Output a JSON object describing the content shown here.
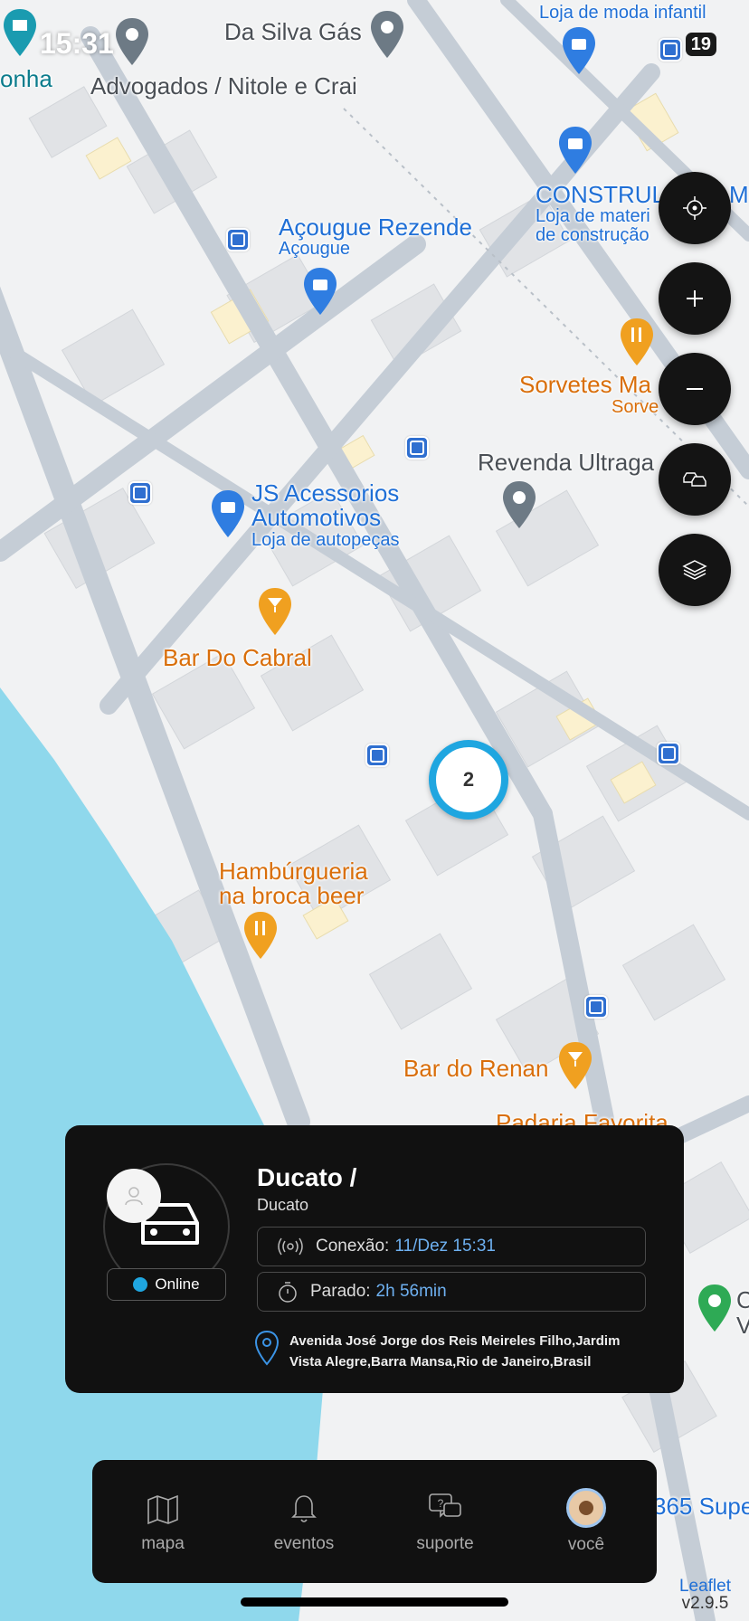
{
  "status_bar": {
    "time": "15:31",
    "battery": "19"
  },
  "map": {
    "labels": {
      "da_silva": "Da Silva Gás",
      "advogados": "Advogados / Nitole e Crai",
      "onha": "onha",
      "loja_moda": "Loja de moda infantil",
      "acougue_title": "Açougue Rezende",
      "acougue_sub": "Açougue",
      "construl_title": "CONSTRUL",
      "construl_title_right": "M",
      "construl_sub1": "Loja de materi",
      "construl_sub2": "de construção",
      "sorvetes_title": "Sorvetes Ma",
      "sorvetes_sub": "Sorve",
      "revenda": "Revenda Ultraga",
      "js_title1": "JS Acessorios",
      "js_title2": "Automotivos",
      "js_sub": "Loja de autopeças",
      "bar_cabral": "Bar Do Cabral",
      "hamb_1": "Hambúrgueria",
      "hamb_2": "na broca beer",
      "bar_renan": "Bar do Renan",
      "padaria": "Padaria Favorita",
      "supe": "365 Supe",
      "right_c": "C",
      "right_v": "V"
    },
    "cluster_count": "2",
    "colors": {
      "water": "#8fd8ec",
      "road": "#c5cdd6",
      "block": "#e2e4e7",
      "cluster_ring": "#1fa6e0"
    }
  },
  "controls": {
    "locate_icon": "crosshair-icon",
    "zoom_in_icon": "plus-icon",
    "zoom_out_icon": "minus-icon",
    "traffic_icon": "cars-icon",
    "layers_icon": "layers-icon"
  },
  "vehicle_card": {
    "title": "Ducato /",
    "subtitle": "Ducato",
    "status": "Online",
    "connection_label": "Conexão:",
    "connection_value": "11/Dez 15:31",
    "stopped_label": "Parado:",
    "stopped_value": "2h 56min",
    "address_line1": "Avenida José Jorge dos Reis Meireles Filho,Jardim",
    "address_line2": "Vista Alegre,Barra Mansa,Rio de Janeiro,Brasil"
  },
  "nav": {
    "items": [
      {
        "label": "mapa",
        "icon": "map-icon"
      },
      {
        "label": "eventos",
        "icon": "bell-icon"
      },
      {
        "label": "suporte",
        "icon": "chat-question-icon"
      },
      {
        "label": "você",
        "icon": "avatar"
      }
    ]
  },
  "attribution": {
    "link": "Leaflet",
    "version": "v2.9.5"
  }
}
